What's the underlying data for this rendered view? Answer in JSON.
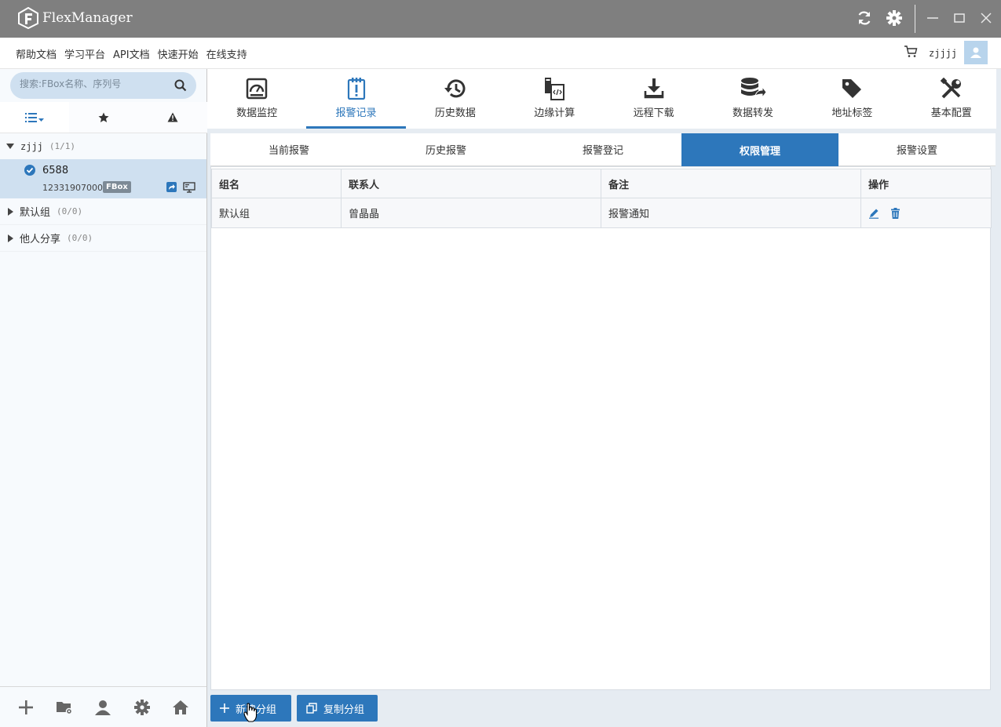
{
  "app": {
    "title": "FlexManager"
  },
  "menu": {
    "links": [
      "帮助文档",
      "学习平台",
      "API文档",
      "快速开始",
      "在线支持"
    ]
  },
  "user": {
    "name": "zjjjj"
  },
  "sidebar": {
    "search_placeholder": "搜索:FBox名称、序列号",
    "groups": [
      {
        "label": "zjjj",
        "count": "(1/1)",
        "expanded": true
      },
      {
        "label": "默认组",
        "count": "(0/0)",
        "expanded": false
      },
      {
        "label": "他人分享",
        "count": "(0/0)",
        "expanded": false
      }
    ],
    "device": {
      "name": "6588",
      "serial": "123319070003",
      "badge": "FBox"
    }
  },
  "toolbar": {
    "items": [
      {
        "label": "数据监控",
        "icon": "monitor-gauge-icon"
      },
      {
        "label": "报警记录",
        "icon": "alarm-clipboard-icon",
        "active": true
      },
      {
        "label": "历史数据",
        "icon": "history-clock-icon"
      },
      {
        "label": "边缘计算",
        "icon": "code-file-icon"
      },
      {
        "label": "远程下载",
        "icon": "download-icon"
      },
      {
        "label": "数据转发",
        "icon": "database-forward-icon"
      },
      {
        "label": "地址标签",
        "icon": "tag-icon"
      },
      {
        "label": "基本配置",
        "icon": "tools-icon"
      }
    ]
  },
  "subtabs": [
    {
      "label": "当前报警"
    },
    {
      "label": "历史报警"
    },
    {
      "label": "报警登记"
    },
    {
      "label": "权限管理",
      "active": true
    },
    {
      "label": "报警设置"
    }
  ],
  "table": {
    "headers": [
      "组名",
      "联系人",
      "备注",
      "操作"
    ],
    "rows": [
      {
        "group": "默认组",
        "contact": "曾晶晶",
        "note": "报警通知"
      }
    ]
  },
  "buttons": {
    "new_group": "新建分组",
    "copy_group": "复制分组"
  },
  "colors": {
    "accent": "#2d77bb",
    "titlebar": "#7f7f7f",
    "sidebar_selected": "#cfe0f0"
  }
}
